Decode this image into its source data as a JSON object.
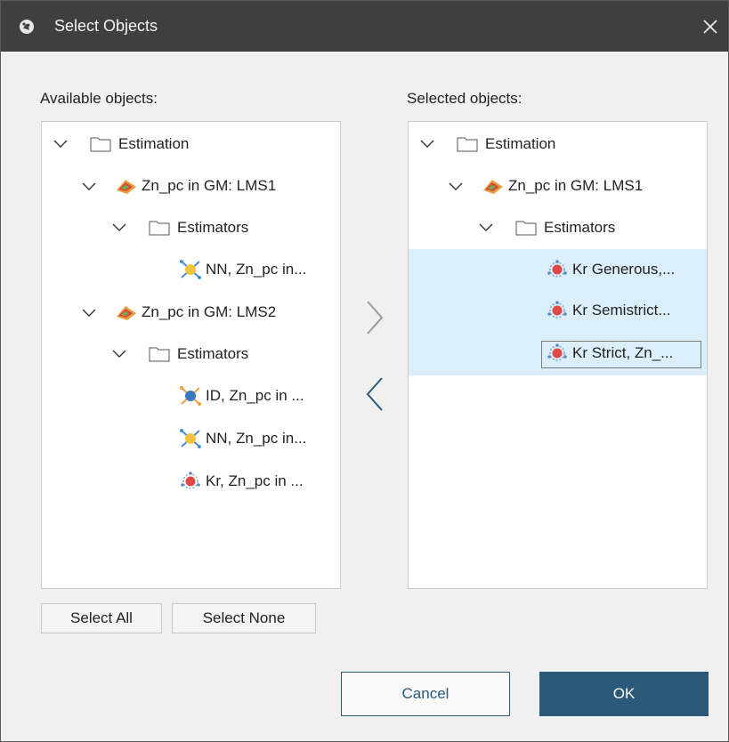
{
  "window": {
    "title": "Select Objects"
  },
  "available": {
    "label": "Available objects:",
    "items": [
      {
        "label": "Estimation"
      },
      {
        "label": "Zn_pc in GM: LMS1"
      },
      {
        "label": "Estimators"
      },
      {
        "label": "NN, Zn_pc in..."
      },
      {
        "label": "Zn_pc in GM: LMS2"
      },
      {
        "label": "Estimators"
      },
      {
        "label": "ID, Zn_pc in ..."
      },
      {
        "label": "NN, Zn_pc in..."
      },
      {
        "label": "Kr, Zn_pc in ..."
      }
    ]
  },
  "selected": {
    "label": "Selected objects:",
    "items": [
      {
        "label": "Estimation"
      },
      {
        "label": "Zn_pc in GM: LMS1"
      },
      {
        "label": "Estimators"
      },
      {
        "label": "Kr Generous,..."
      },
      {
        "label": "Kr Semistrict..."
      },
      {
        "label": "Kr Strict, Zn_..."
      }
    ]
  },
  "buttons": {
    "select_all": "Select All",
    "select_none": "Select None",
    "cancel": "Cancel",
    "ok": "OK"
  },
  "colors": {
    "titlebar": "#3f3f3f",
    "accent": "#2b5a78",
    "selection": "#dbeffa"
  }
}
